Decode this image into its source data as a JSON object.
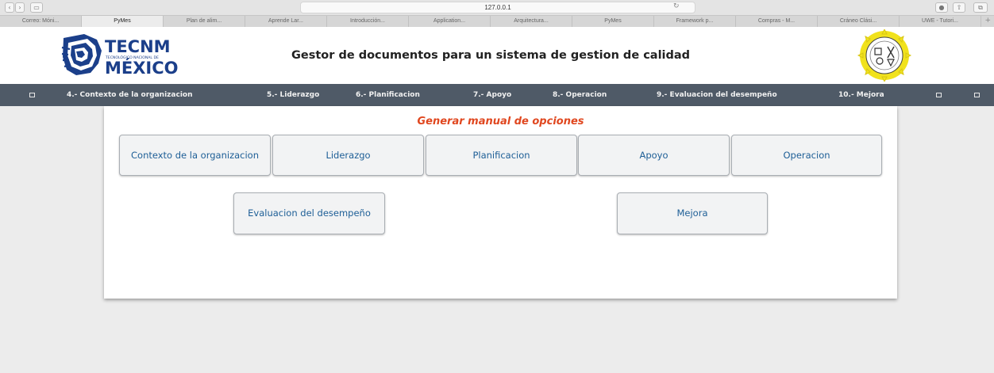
{
  "browser": {
    "url": "127.0.0.1",
    "tabs": [
      "Correo: Móni...",
      "PyMes",
      "Plan de alim...",
      "Aprende Lar...",
      "Introducción...",
      "Application...",
      "Arquitectura...",
      "PyMes",
      "Framework p...",
      "Compras - M...",
      "Cráneo Clási...",
      "UWE - Tutori..."
    ],
    "active_tab_index": 1
  },
  "header": {
    "title": "Gestor de documentos para un sistema de gestion de calidad",
    "logo_text": "TECNM",
    "logo_subtext": "TECNOLÓGICO NACIONAL DE",
    "logo_text2": "MÉXICO"
  },
  "nav": {
    "items": [
      "4.- Contexto de la organizacion",
      "5.- Liderazgo",
      "6.- Planificacion",
      "7.- Apoyo",
      "8.- Operacion",
      "9.- Evaluacion del desempeño",
      "10.- Mejora"
    ]
  },
  "main": {
    "title": "Generar manual de opciones",
    "options": [
      "Contexto de la organizacion",
      "Liderazgo",
      "Planificacion",
      "Apoyo",
      "Operacion",
      "Evaluacion del desempeño",
      "Mejora"
    ]
  },
  "colors": {
    "nav_bg": "#4f5a67",
    "title_accent": "#e0471f",
    "button_text": "#1d5e96",
    "logo_blue": "#1b3f8a"
  }
}
